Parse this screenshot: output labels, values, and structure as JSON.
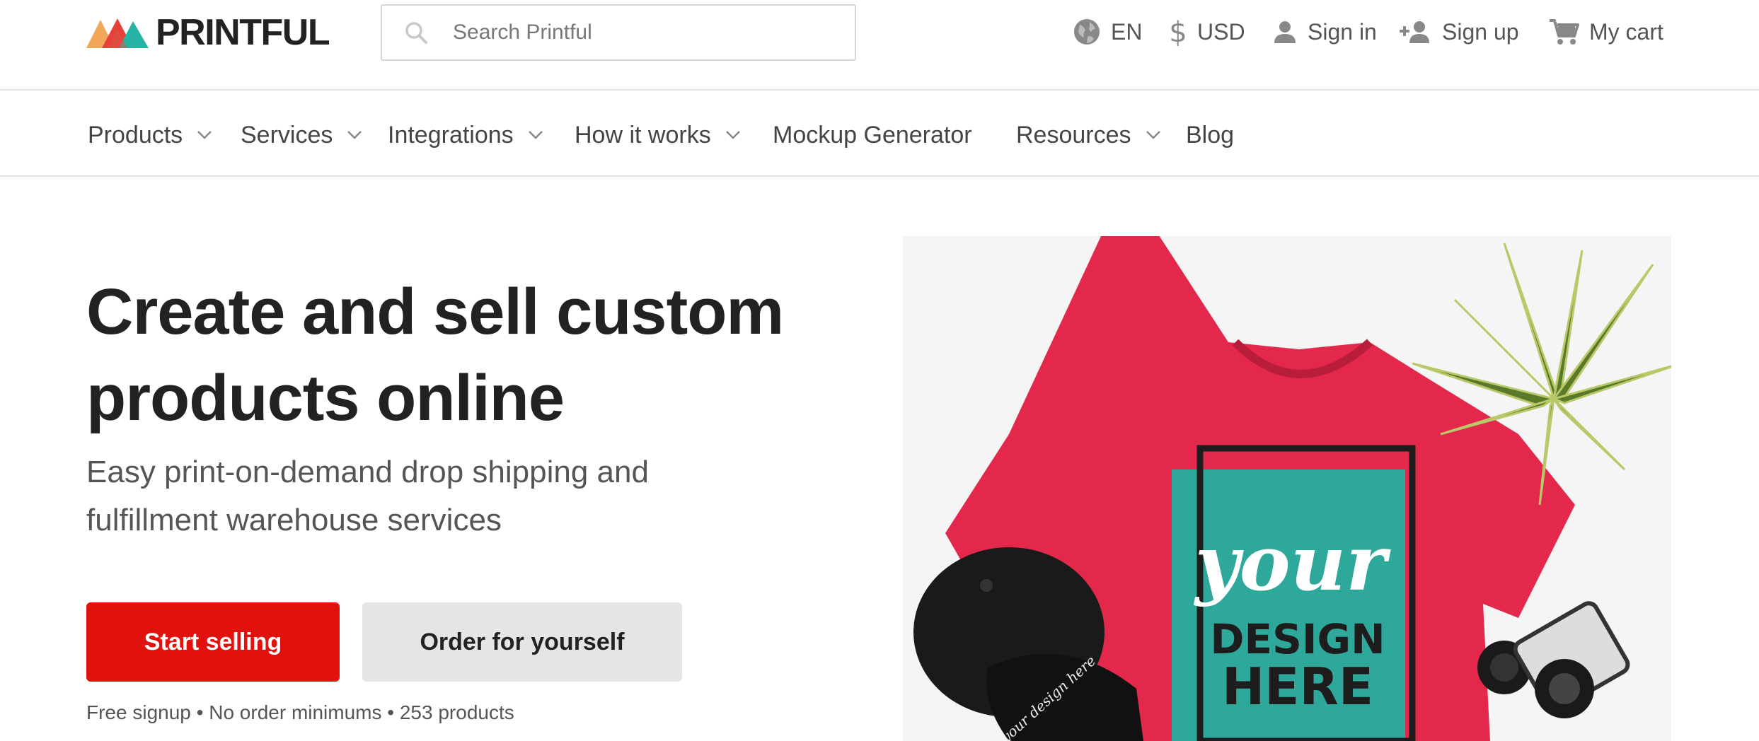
{
  "brand": {
    "name": "PRINTFUL",
    "colors": {
      "orange": "#f2a65a",
      "red": "#e6403a",
      "teal": "#27b3a4",
      "accent_red": "#e1120d"
    }
  },
  "search": {
    "placeholder": "Search Printful",
    "icon": "search-icon"
  },
  "utility": {
    "language": {
      "label": "EN",
      "icon": "globe-icon"
    },
    "currency": {
      "label": "USD",
      "icon": "dollar-icon"
    },
    "sign_in": {
      "label": "Sign in",
      "icon": "user-icon"
    },
    "sign_up": {
      "label": "Sign up",
      "icon": "add-user-icon"
    },
    "cart": {
      "label": "My cart",
      "icon": "cart-icon"
    }
  },
  "nav": {
    "items": [
      {
        "label": "Products",
        "has_dropdown": true
      },
      {
        "label": "Services",
        "has_dropdown": true
      },
      {
        "label": "Integrations",
        "has_dropdown": true
      },
      {
        "label": "How it works",
        "has_dropdown": true
      },
      {
        "label": "Mockup Generator",
        "has_dropdown": false
      },
      {
        "label": "Resources",
        "has_dropdown": true
      },
      {
        "label": "Blog",
        "has_dropdown": false
      }
    ]
  },
  "hero": {
    "title_line1": "Create and sell custom",
    "title_line2": "products online",
    "subtitle_line1": "Easy print-on-demand drop shipping and",
    "subtitle_line2": "fulfillment warehouse services",
    "primary_cta": "Start selling",
    "secondary_cta": "Order for yourself",
    "fineprint": "Free signup • No order minimums • 253 products",
    "image": {
      "shirt_text_script": "your",
      "shirt_text_line1": "DESIGN",
      "shirt_text_line2": "HERE",
      "cap_text": "your design here"
    }
  }
}
